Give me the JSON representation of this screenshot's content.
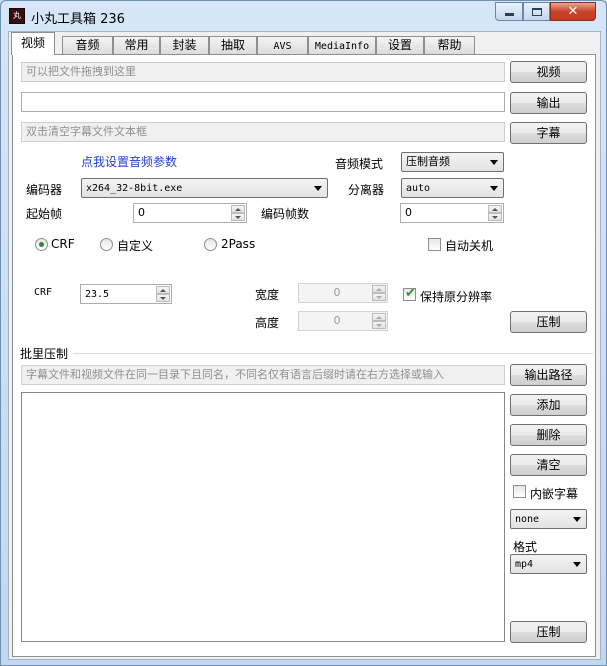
{
  "window": {
    "title": "小丸工具箱 236",
    "icon": "丸"
  },
  "tabs": [
    "视频",
    "音频",
    "常用",
    "封装",
    "抽取",
    "AVS",
    "MediaInfo",
    "设置",
    "帮助"
  ],
  "video": {
    "drop_placeholder": "可以把文件拖拽到这里",
    "output_value": "",
    "subtitle_placeholder": "双击清空字幕文件文本框",
    "btn_video": "视频",
    "btn_output": "输出",
    "btn_subtitle": "字幕",
    "audio_settings_link": "点我设置音频参数",
    "audio_mode_label": "音频模式",
    "audio_mode_value": "压制音频",
    "encoder_label": "编码器",
    "encoder_value": "x264_32-8bit.exe",
    "splitter_label": "分离器",
    "splitter_value": "auto",
    "start_frame_label": "起始帧",
    "start_frame_value": "0",
    "encode_frames_label": "编码帧数",
    "encode_frames_value": "0",
    "mode_crf": "CRF",
    "mode_custom": "自定义",
    "mode_2pass": "2Pass",
    "auto_shutdown": "自动关机",
    "crf_label": "CRF",
    "crf_value": "23.5",
    "width_label": "宽度",
    "width_value": "0",
    "height_label": "高度",
    "height_value": "0",
    "keep_resolution": "保持原分辨率",
    "btn_encode": "压制"
  },
  "batch": {
    "title": "批里压制",
    "hint": "字幕文件和视频文件在同一目录下且同名，不同名仅有语言后缀时请在右方选择或输入",
    "btn_output_path": "输出路径",
    "btn_add": "添加",
    "btn_delete": "删除",
    "btn_clear": "清空",
    "embed_subtitle": "内嵌字幕",
    "subtitle_lang_value": "none",
    "format_label": "格式",
    "format_value": "mp4",
    "btn_encode": "压制"
  },
  "state": {
    "mode_selected": "CRF",
    "keep_resolution_checked": true,
    "auto_shutdown_checked": false,
    "embed_subtitle_checked": false
  }
}
